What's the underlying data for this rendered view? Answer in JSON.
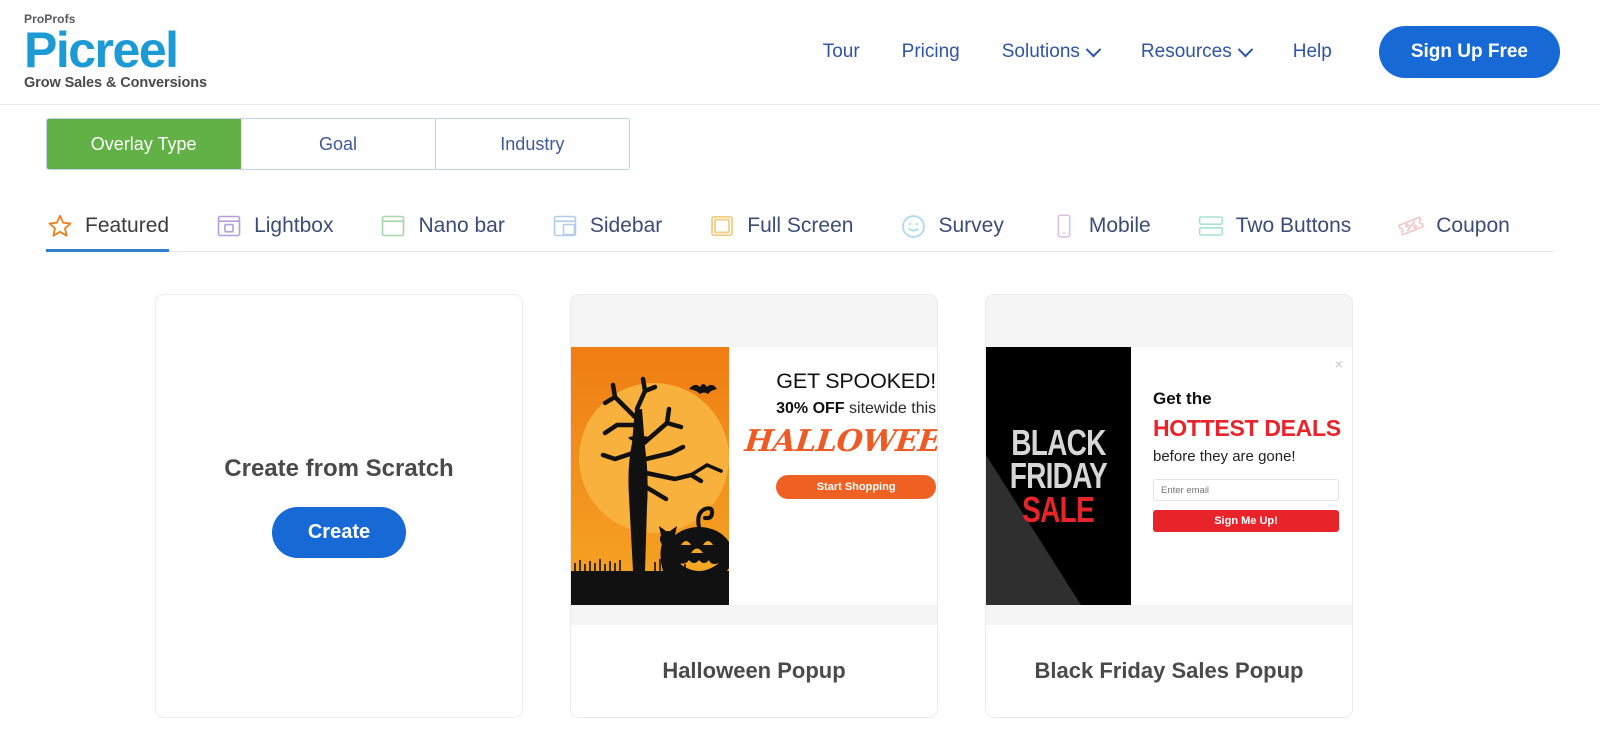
{
  "header": {
    "logo": {
      "pro": "ProProfs",
      "main": "Picreel",
      "tagline": "Grow Sales & Conversions"
    },
    "nav": [
      {
        "label": "Tour",
        "has_chevron": false
      },
      {
        "label": "Pricing",
        "has_chevron": false
      },
      {
        "label": "Solutions",
        "has_chevron": true
      },
      {
        "label": "Resources",
        "has_chevron": true
      },
      {
        "label": "Help",
        "has_chevron": false
      }
    ],
    "signup_label": "Sign Up Free"
  },
  "segmented": {
    "items": [
      {
        "label": "Overlay Type",
        "active": true
      },
      {
        "label": "Goal",
        "active": false
      },
      {
        "label": "Industry",
        "active": false
      }
    ],
    "active_color": "#62b146"
  },
  "category_tabs": [
    {
      "label": "Featured",
      "icon": "star-icon",
      "icon_color": "#ef7f22",
      "active": true
    },
    {
      "label": "Lightbox",
      "icon": "lightbox-icon",
      "icon_color": "#b39ddb",
      "active": false
    },
    {
      "label": "Nano bar",
      "icon": "nano-bar-icon",
      "icon_color": "#a5d6a7",
      "active": false
    },
    {
      "label": "Sidebar",
      "icon": "sidebar-icon",
      "icon_color": "#b3cde8",
      "active": false
    },
    {
      "label": "Full Screen",
      "icon": "full-screen-icon",
      "icon_color": "#f5cb7a",
      "active": false
    },
    {
      "label": "Survey",
      "icon": "survey-smiley-icon",
      "icon_color": "#a8d8ef",
      "active": false
    },
    {
      "label": "Mobile",
      "icon": "mobile-icon",
      "icon_color": "#ddbfe8",
      "active": false
    },
    {
      "label": "Two Buttons",
      "icon": "two-buttons-icon",
      "icon_color": "#a7e0d6",
      "active": false
    },
    {
      "label": "Coupon",
      "icon": "coupon-icon",
      "icon_color": "#f2c3c3",
      "active": false
    }
  ],
  "cards": {
    "scratch": {
      "title": "Create from Scratch",
      "button_label": "Create"
    },
    "halloween": {
      "title": "Halloween Popup",
      "headline": "GET SPOOKED!",
      "sub_bold": "30% OFF",
      "sub_rest": " sitewide this",
      "script_word": "HALLOWEEN",
      "cta_label": "Start Shopping",
      "accent": "#ee6123"
    },
    "blackfriday": {
      "title": "Black Friday Sales Popup",
      "art_line1": "BLACK",
      "art_line2": "FRIDAY",
      "art_line3": "SALE",
      "headline": "Get the",
      "emphasis": "HOTTEST DEALS",
      "subline": "before they are gone!",
      "email_placeholder": "Enter email",
      "cta_label": "Sign Me Up!",
      "close_glyph": "×",
      "accent": "#e8232a"
    }
  }
}
